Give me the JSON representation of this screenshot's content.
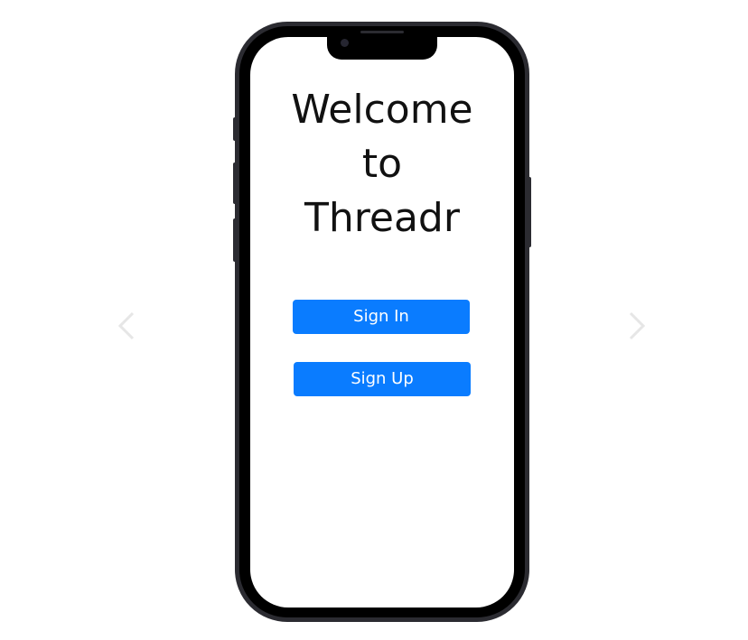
{
  "carousel": {
    "prev_icon": "chevron-left-icon",
    "next_icon": "chevron-right-icon"
  },
  "screen": {
    "title_lines": [
      "Welcome",
      "to",
      "Threadr"
    ],
    "buttons": {
      "sign_in": "Sign In",
      "sign_up": "Sign Up"
    }
  },
  "colors": {
    "accent": "#0a7cff",
    "phone_frame": "#2b2b31",
    "arrow": "#e6e6e6"
  }
}
